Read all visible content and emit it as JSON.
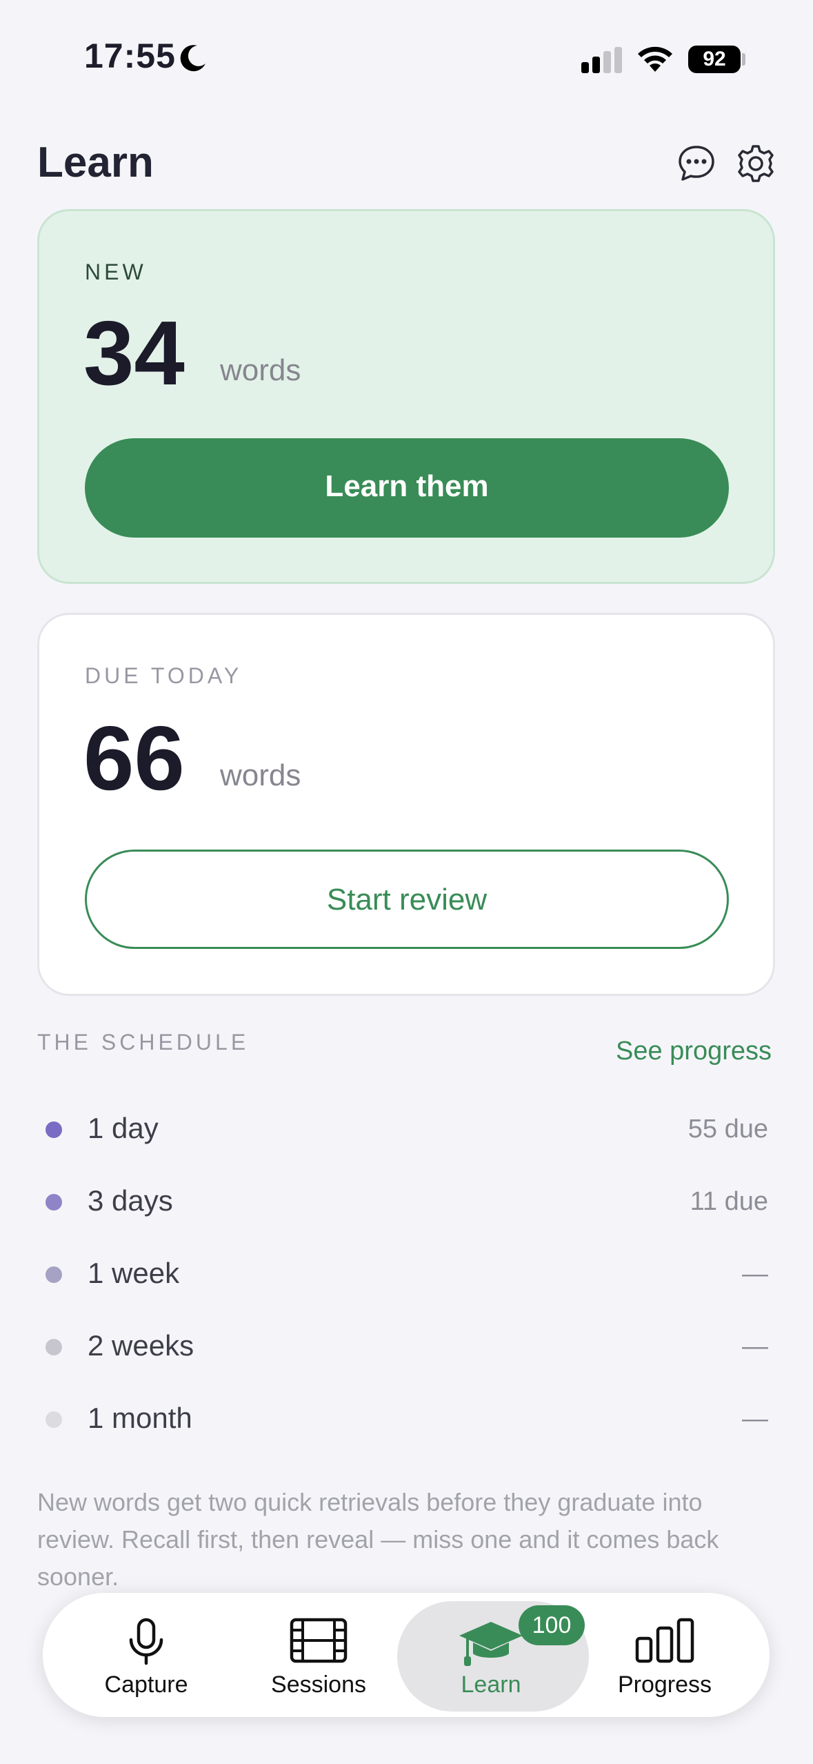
{
  "status_bar": {
    "time": "17:55",
    "battery": "92"
  },
  "header": {
    "title": "Learn"
  },
  "new_card": {
    "label": "NEW",
    "count": "34",
    "unit": "words",
    "button": "Learn them"
  },
  "due_card": {
    "label": "DUE TODAY",
    "count": "66",
    "unit": "words",
    "button": "Start review"
  },
  "schedule": {
    "title": "THE SCHEDULE",
    "link": "See progress",
    "rows": [
      {
        "label": "1 day",
        "value": "55 due",
        "color": "#7a6bc4"
      },
      {
        "label": "3 days",
        "value": "11 due",
        "color": "#8f84c8"
      },
      {
        "label": "1 week",
        "value": "—",
        "color": "#a6a2c4"
      },
      {
        "label": "2 weeks",
        "value": "—",
        "color": "#c7c6cf"
      },
      {
        "label": "1 month",
        "value": "—",
        "color": "#dcdce0"
      }
    ]
  },
  "footnote": "New words get two quick retrievals before they graduate into review. Recall first, then reveal — miss one and it comes back sooner.",
  "tabs": [
    {
      "label": "Capture",
      "icon": "microphone-icon"
    },
    {
      "label": "Sessions",
      "icon": "film-icon"
    },
    {
      "label": "Learn",
      "icon": "graduation-cap-icon",
      "badge": "100",
      "active": true
    },
    {
      "label": "Progress",
      "icon": "bar-chart-icon"
    }
  ],
  "colors": {
    "accent": "#398c57",
    "new_card_bg": "#e3f2e8",
    "background": "#f5f5f9"
  }
}
